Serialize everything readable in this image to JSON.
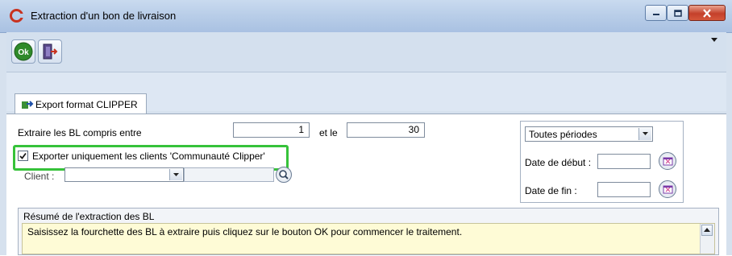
{
  "window": {
    "title": "Extraction d'un bon de livraison",
    "buttons": {
      "ok_label": "Ok"
    }
  },
  "tab": {
    "label": "Export format CLIPPER"
  },
  "form": {
    "range_label": "Extraire les BL compris entre",
    "range_from": "1",
    "range_and_label": "et le",
    "range_to": "30",
    "export_checkbox_label": "Exporter uniquement les clients  'Communauté Clipper'",
    "export_checked": true,
    "client_label": "Client :",
    "client_value": ""
  },
  "periode": {
    "selected": "Toutes périodes",
    "date_debut_label": "Date de début :",
    "date_debut_value": "",
    "date_fin_label": "Date de fin :",
    "date_fin_value": ""
  },
  "resume": {
    "title": "Résumé de l'extraction des BL",
    "text": "Saisissez la fourchette des BL à extraire puis cliquez sur le bouton OK pour commencer le traitement."
  },
  "colors": {
    "highlight": "#36c23a",
    "memo_bg": "#fefbd6",
    "titlebar": "#b8cde8"
  }
}
